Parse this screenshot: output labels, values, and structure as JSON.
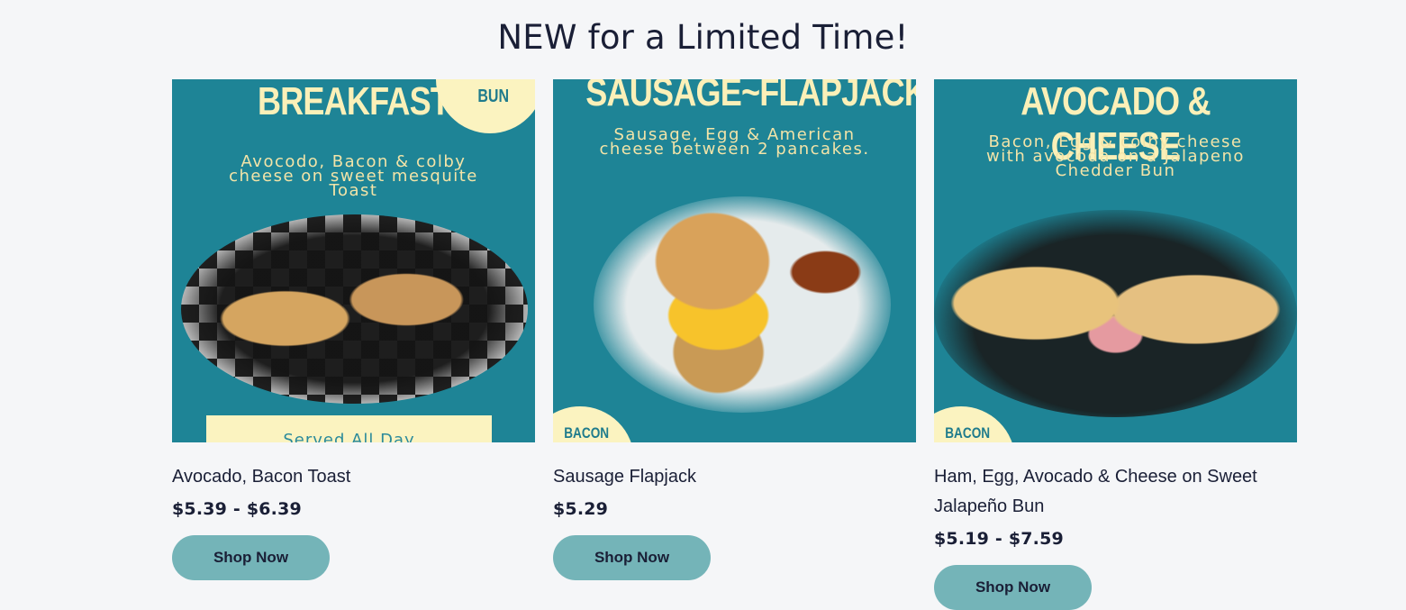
{
  "section": {
    "title": "NEW for a Limited Time!"
  },
  "products": [
    {
      "image": {
        "headline": "BREAKFAST",
        "description": "Avocodo, Bacon & colby cheese on sweet mesquite Toast",
        "corner_badge": "BUN",
        "banner": "Served All Day"
      },
      "name": "Avocado, Bacon Toast",
      "price": "$5.39 - $6.39",
      "button_label": "Shop Now"
    },
    {
      "image": {
        "headline": "SAUSAGE~FLAPJACK",
        "description": "Sausage, Egg & American cheese between 2 pancakes.",
        "corner_badge": "BACON"
      },
      "name": "Sausage Flapjack",
      "price": "$5.29",
      "button_label": "Shop Now"
    },
    {
      "image": {
        "headline": "AVOCADO & CHEESE",
        "description": "Bacon, Egg & colby cheese with avocoda on a Jalapeno Chedder Bun",
        "corner_badge": "BACON"
      },
      "name": "Ham, Egg, Avocado & Cheese on Sweet Jalapeño Bun",
      "price": "$5.19 - $7.59",
      "button_label": "Shop Now"
    }
  ],
  "colors": {
    "background": "#f5f6f8",
    "image_teal": "#1e8496",
    "cream": "#fbf3c0",
    "button": "#74b4b8",
    "text": "#1a1f36"
  }
}
